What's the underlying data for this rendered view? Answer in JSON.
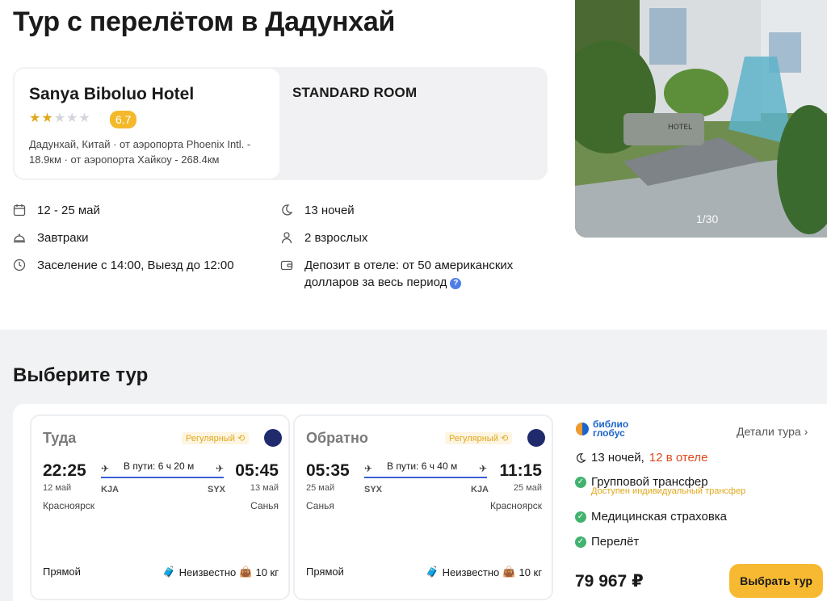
{
  "page": {
    "title": "Тур с перелётом в Дадунхай"
  },
  "hotel": {
    "name": "Sanya Biboluo Hotel",
    "stars": 2,
    "stars_max": 5,
    "rating": "6.7",
    "address": "Дадунхай, Китай · от аэропорта Phoenix Intl. - 18.9км · от аэропорта Хайкоу - 268.4км",
    "room": "STANDARD ROOM"
  },
  "facts": {
    "dates": "12 - 25 май",
    "nights": "13 ночей",
    "meal": "Завтраки",
    "guests": "2 взрослых",
    "checkin": "Заселение с 14:00, Выезд до 12:00",
    "deposit": "Депозит в отеле: от 50 американских долларов за весь период",
    "deposit_help": "?"
  },
  "gallery": {
    "counter": "1/30",
    "sign_text": "HOTEL"
  },
  "tours": {
    "section_title": "Выберите тур"
  },
  "outbound": {
    "direction": "Туда",
    "tag": "Регулярный",
    "dep_time": "22:25",
    "dep_date": "12 май",
    "dep_code": "KJA",
    "dep_city": "Красноярск",
    "duration": "В пути: 6 ч 20 м",
    "arr_time": "05:45",
    "arr_date": "13 май",
    "arr_code": "SYX",
    "arr_city": "Санья",
    "type": "Прямой",
    "baggage": "Неизвестно",
    "hand": "10 кг"
  },
  "inbound": {
    "direction": "Обратно",
    "tag": "Регулярный",
    "dep_time": "05:35",
    "dep_date": "25 май",
    "dep_code": "SYX",
    "dep_city": "Санья",
    "duration": "В пути: 6 ч 40 м",
    "arr_time": "11:15",
    "arr_date": "25 май",
    "arr_code": "KJA",
    "arr_city": "Красноярск",
    "type": "Прямой",
    "baggage": "Неизвестно",
    "hand": "10 кг"
  },
  "offer": {
    "operator_line1": "библио",
    "operator_line2": "глобус",
    "details": "Детали тура",
    "nights": "13 ночей,",
    "hotel_nights": "12 в отеле",
    "transfer": "Групповой трансфер",
    "transfer_note": "Доступен индивидуальный трансфер",
    "insurance": "Медицинская страховка",
    "flight": "Перелёт",
    "price": "79 967 ₽",
    "cta": "Выбрать тур"
  },
  "colors": {
    "accent": "#f6b931",
    "blue": "#3c5fd6",
    "green": "#42b36f",
    "red": "#e04a1e"
  }
}
